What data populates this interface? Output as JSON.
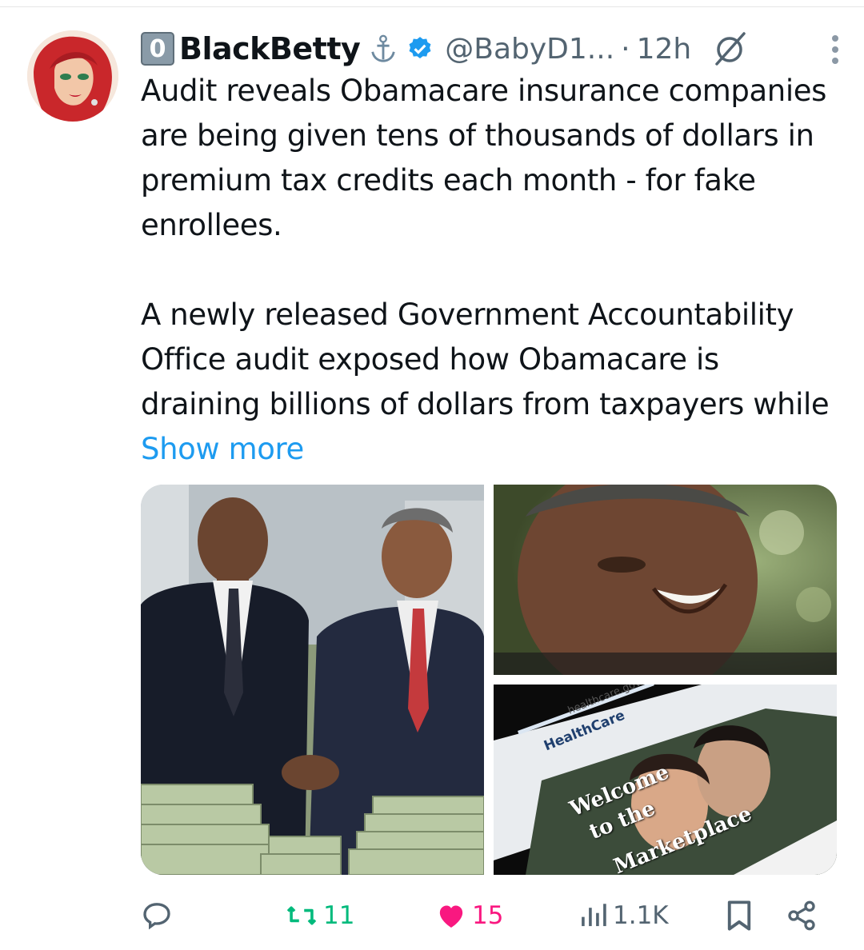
{
  "post": {
    "badge": "0",
    "display_name": "BlackBetty",
    "handle": "@BabyD1...",
    "separator": "·",
    "time": "12h",
    "text": "Audit reveals Obamacare insurance companies are being given tens of thousands of dollars in premium tax credits each month - for fake enrollees.\n\nA newly released Government Accountability Office audit exposed how Obamacare is draining billions of dollars from taxpayers while ",
    "show_more": "Show more"
  },
  "media": {
    "image3": {
      "site": "HealthCare",
      "domain": "healthcare.gov",
      "line1": "Welcome",
      "line2": "to the",
      "line3": "Marketplace"
    }
  },
  "actions": {
    "reposts": "11",
    "likes": "15",
    "views": "1.1K"
  },
  "colors": {
    "accent": "#1d9bf0",
    "repost": "#00ba7c",
    "like": "#f91880",
    "muted": "#536471"
  },
  "icons": [
    "avatar",
    "anchor-icon",
    "verified-icon",
    "grok-icon",
    "more-icon",
    "reply-icon",
    "retweet-icon",
    "heart-icon",
    "views-icon",
    "bookmark-icon",
    "share-icon"
  ]
}
